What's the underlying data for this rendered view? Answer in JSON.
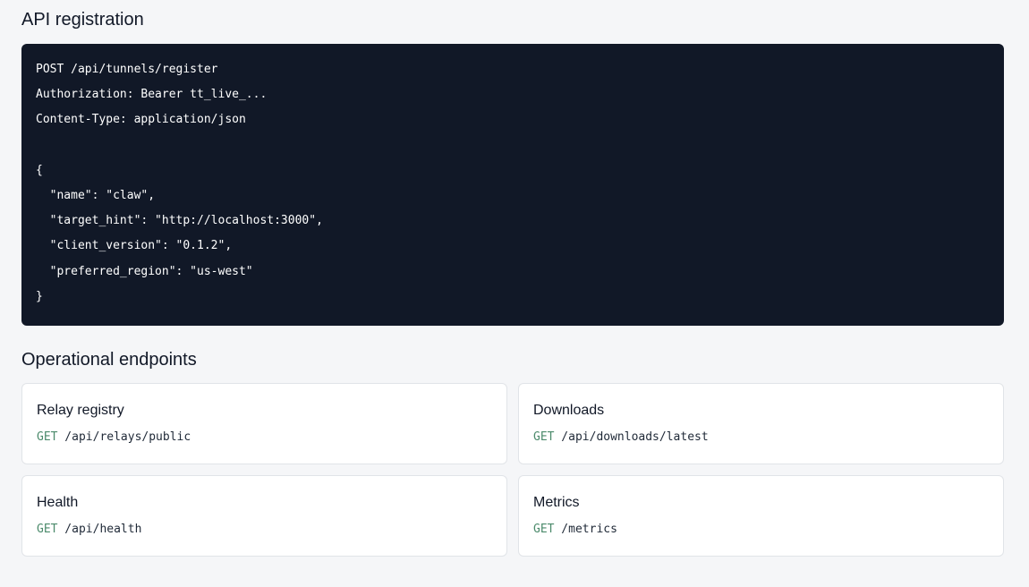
{
  "sections": {
    "api_registration_title": "API registration",
    "operational_title": "Operational endpoints"
  },
  "code_block": {
    "lines": [
      "POST /api/tunnels/register",
      "Authorization: Bearer tt_live_...",
      "Content-Type: application/json",
      "",
      "{",
      "  \"name\": \"claw\",",
      "  \"target_hint\": \"http://localhost:3000\",",
      "  \"client_version\": \"0.1.2\",",
      "  \"preferred_region\": \"us-west\"",
      "}"
    ]
  },
  "endpoints": [
    {
      "title": "Relay registry",
      "method": "GET",
      "path": " /api/relays/public"
    },
    {
      "title": "Downloads",
      "method": "GET",
      "path": " /api/downloads/latest"
    },
    {
      "title": "Health",
      "method": "GET",
      "path": " /api/health"
    },
    {
      "title": "Metrics",
      "method": "GET",
      "path": " /metrics"
    }
  ],
  "colors": {
    "code_bg": "#111827",
    "page_bg": "#f5f6f8",
    "method": "#4b8a6b"
  }
}
